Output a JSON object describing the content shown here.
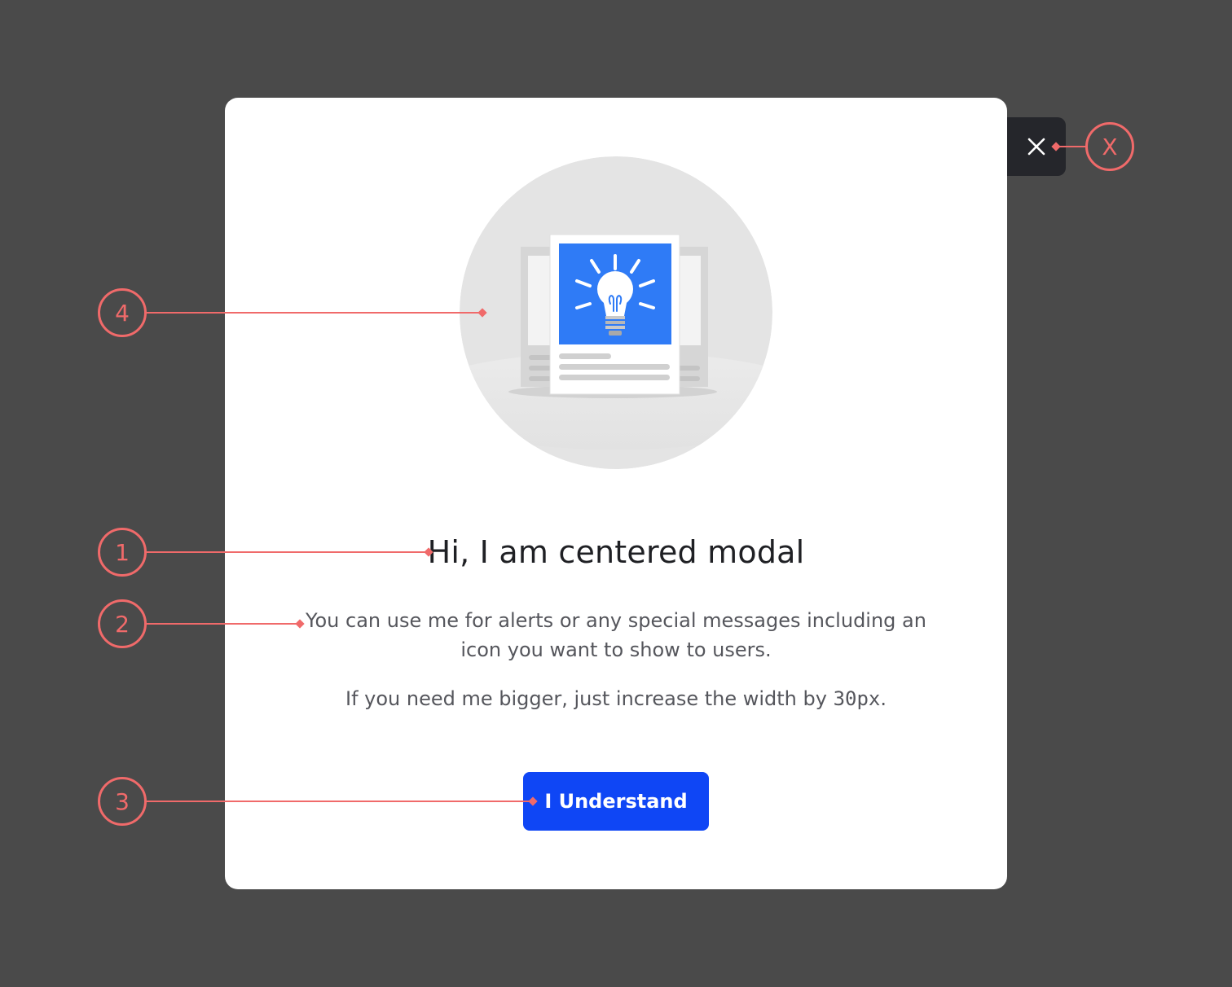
{
  "modal": {
    "title": "Hi, I am centered modal",
    "description": "You can use me for alerts or any special messages including an icon you want to show to users.",
    "note_prefix": "If you need me bigger, just increase the width by ",
    "note_code": "30px",
    "note_suffix": ".",
    "primary_button_label": "I Understand",
    "close_icon": "close-icon",
    "illustration_icon": "lightbulb-document-icon"
  },
  "annotations": {
    "title_marker": "1",
    "description_marker": "2",
    "button_marker": "3",
    "illustration_marker": "4",
    "close_marker": "X"
  },
  "colors": {
    "backdrop": "#4a4a4a",
    "modal_bg": "#ffffff",
    "close_bg": "#25262b",
    "primary": "#0f46f5",
    "illustration_blue": "#2f7bf6",
    "annotation": "#f06a6a"
  }
}
